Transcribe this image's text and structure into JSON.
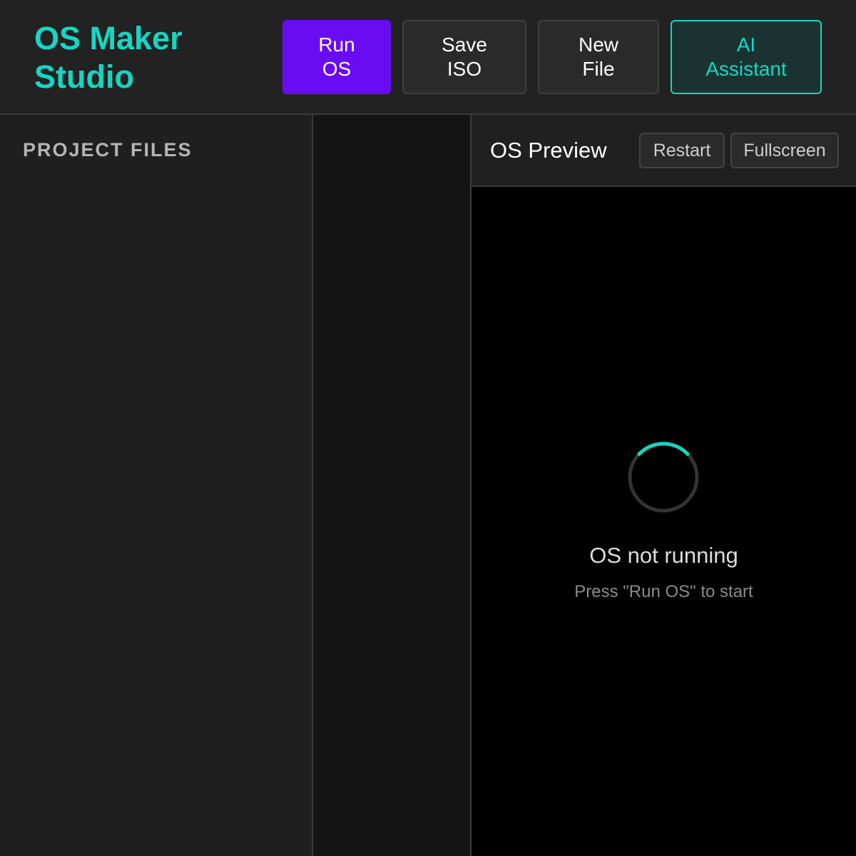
{
  "app": {
    "title": "OS Maker\nStudio"
  },
  "toolbar": {
    "run_label": "Run\nOS",
    "save_label": "Save\nISO",
    "new_label": "New\nFile",
    "ai_label": "AI\nAssistant"
  },
  "sidebar": {
    "title": "PROJECT FILES",
    "items": []
  },
  "preview": {
    "title": "OS Preview",
    "restart_label": "Restart",
    "fullscreen_label": "Fullscreen",
    "status": "OS not running",
    "hint": "Press \"Run OS\" to start",
    "spinner_icon": "loading-spinner-icon"
  },
  "colors": {
    "accent": "#16d6c3",
    "primary": "#6a0cf2",
    "background": "#1e1e1e",
    "preview_background": "#000000"
  }
}
